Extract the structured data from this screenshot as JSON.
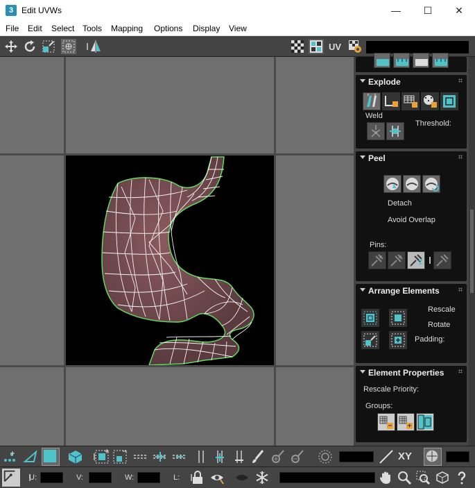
{
  "window": {
    "title": "Edit UVWs",
    "app_icon_glyph": "3"
  },
  "menu": [
    "File",
    "Edit",
    "Select",
    "Tools",
    "Mapping",
    "Options",
    "Display",
    "View"
  ],
  "toolbar": {
    "uv_label": "UV"
  },
  "rollouts": {
    "explode": {
      "title": "Explode",
      "weld_label": "Weld",
      "threshold_label": "Threshold:"
    },
    "peel": {
      "title": "Peel",
      "detach_label": "Detach",
      "avoid_overlap_label": "Avoid Overlap",
      "pins_label": "Pins:"
    },
    "arrange": {
      "title": "Arrange Elements",
      "rescale_label": "Rescale",
      "rotate_label": "Rotate",
      "padding_label": "Padding:"
    },
    "element_properties": {
      "title": "Element Properties",
      "rescale_priority_label": "Rescale Priority:",
      "groups_label": "Groups:"
    }
  },
  "statusbar": {
    "xy_label": "XY",
    "u_label": "U:",
    "v_label": "V:",
    "w_label": "W:",
    "l_label": "L:"
  },
  "colors": {
    "accent": "#4fc3c9",
    "mesh_fill": "#6e4a4e",
    "wire": "#ffffff",
    "border_green": "#5fdc5f"
  }
}
